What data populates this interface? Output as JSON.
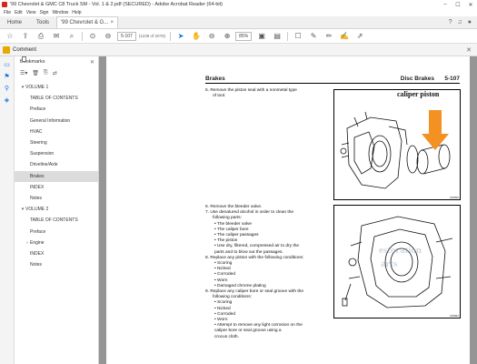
{
  "window": {
    "title": "'99 Chevrolet & GMC C8 Truck SM - Vol. 1 & 2.pdf (SECURED) - Adobe Acrobat Reader (64-bit)",
    "minimize": "–",
    "maximize": "☐",
    "close": "✕"
  },
  "menu": [
    "File",
    "Edit",
    "View",
    "Sign",
    "Window",
    "Help"
  ],
  "tabs": {
    "home": "Home",
    "tools": "Tools",
    "document": "'99 Chevrolet & G...",
    "document_close": "×"
  },
  "toolbar": {
    "page_number": "5-107",
    "page_total": "(1239 of 2076)",
    "zoom": "85%"
  },
  "comment_bar": {
    "label": "Comment",
    "close": "✕"
  },
  "bookmarks": {
    "title": "Bookmarks",
    "close": "✕",
    "items": [
      {
        "label": "VOLUME 1",
        "level": 0,
        "arrow": "▾",
        "selected": false
      },
      {
        "label": "TABLE OF CONTENTS",
        "level": 1,
        "arrow": "",
        "selected": false
      },
      {
        "label": "Preface",
        "level": 1,
        "arrow": "",
        "selected": false
      },
      {
        "label": "General Information",
        "level": 1,
        "arrow": "",
        "selected": false
      },
      {
        "label": "HVAC",
        "level": 1,
        "arrow": "",
        "selected": false
      },
      {
        "label": "Steering",
        "level": 1,
        "arrow": "",
        "selected": false
      },
      {
        "label": "Suspension",
        "level": 1,
        "arrow": "",
        "selected": false
      },
      {
        "label": "Driveline/Axle",
        "level": 1,
        "arrow": "",
        "selected": false
      },
      {
        "label": "Brakes",
        "level": 1,
        "arrow": "",
        "selected": true
      },
      {
        "label": "INDEX",
        "level": 1,
        "arrow": "",
        "selected": false
      },
      {
        "label": "Notes",
        "level": 1,
        "arrow": "",
        "selected": false
      },
      {
        "label": "VOLUME 2",
        "level": 0,
        "arrow": "▾",
        "selected": false
      },
      {
        "label": "TABLE OF CONTENTS",
        "level": 1,
        "arrow": "",
        "selected": false
      },
      {
        "label": "Preface",
        "level": 1,
        "arrow": "",
        "selected": false
      },
      {
        "label": "Engine",
        "level": 1,
        "arrow": "›",
        "selected": false
      },
      {
        "label": "INDEX",
        "level": 1,
        "arrow": "",
        "selected": false
      },
      {
        "label": "Notes",
        "level": 1,
        "arrow": "",
        "selected": false
      }
    ]
  },
  "document_page": {
    "header_left": "Brakes",
    "header_section": "Disc Brakes",
    "header_page": "5-107",
    "step5": [
      "5.  Remove the piston seal with a nonmetal type",
      "of tool."
    ],
    "fig1_code": "156860",
    "caliper_label": "caliper piston",
    "steps_b": [
      {
        "t": "6.  Remove the bleeder valve.",
        "c": "row"
      },
      {
        "t": "7.  Use denatured alcohol in order to clean the",
        "c": "row"
      },
      {
        "t": "following parts:",
        "c": "row ind"
      },
      {
        "t": "• The bleeder valve",
        "c": "row bul"
      },
      {
        "t": "• The caliper bore",
        "c": "row bul"
      },
      {
        "t": "• The caliper passages",
        "c": "row bul"
      },
      {
        "t": "• The piston",
        "c": "row bul"
      },
      {
        "t": "• Use dry, filtered, compressed air to dry the",
        "c": "row bul"
      },
      {
        "t": "parts and to blow out the passages.",
        "c": "row bul"
      },
      {
        "t": "8.  Replace any piston with the following conditions:",
        "c": "row"
      },
      {
        "t": "• Scoring",
        "c": "row bul"
      },
      {
        "t": "• Nicked",
        "c": "row bul"
      },
      {
        "t": "• Corroded",
        "c": "row bul"
      },
      {
        "t": "• Worn",
        "c": "row bul"
      },
      {
        "t": "• Damaged chrome plating",
        "c": "row bul"
      },
      {
        "t": "9.  Replace any caliper bore or seal groove with the",
        "c": "row"
      },
      {
        "t": "following conditions:",
        "c": "row ind"
      },
      {
        "t": "• Scoring",
        "c": "row bul"
      },
      {
        "t": "• Nicked",
        "c": "row bul"
      },
      {
        "t": "• Corroded",
        "c": "row bul"
      },
      {
        "t": "• Worn",
        "c": "row bul"
      },
      {
        "t": "• Attempt to remove any light corrosion on the",
        "c": "row bul"
      },
      {
        "t": "caliper bore or seal groove using a",
        "c": "row bul"
      },
      {
        "t": "crocus cloth.",
        "c": "row bul"
      }
    ],
    "fig2_code": "156862",
    "watermark_1": "estoration",
    "watermark_2": "arts"
  },
  "colors": {
    "accent": "#1473e6",
    "arrow_orange": "#f39222",
    "doc_background": "#959595",
    "selected_bookmark": "#dcdcdc"
  }
}
